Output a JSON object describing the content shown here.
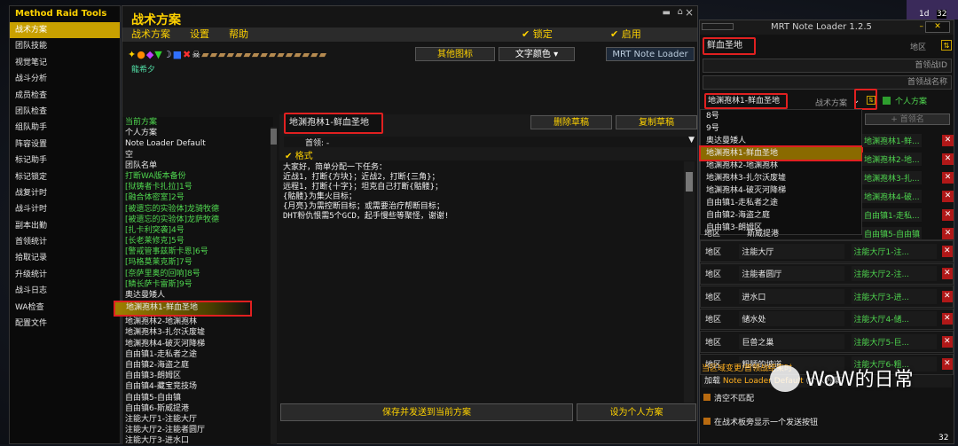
{
  "mrt_panel": {
    "title": "Method Raid Tools",
    "items": [
      "战术方案",
      "团队技能",
      "视觉笔记",
      "战斗分析",
      "成员检查",
      "团队检查",
      "组队助手",
      "阵容设置",
      "标记助手",
      "标记锁定",
      "战复计时",
      "战斗计时",
      "副本出勤",
      "首领统计",
      "拾取记录",
      "升级统计",
      "战斗日志",
      "WA检查",
      "配置文件"
    ]
  },
  "tactics": {
    "title": "战术方案",
    "menu": [
      "战术方案",
      "设置",
      "帮助"
    ],
    "lock_label": "锁定",
    "enable_label": "启用",
    "other_icons": "其他图标",
    "text_color": "文字颜色",
    "mrt_note_loader": "MRT Note Loader",
    "author": "龍希夕",
    "current_plan": "当前方案",
    "list": [
      "个人方案",
      "Note Loader Default",
      "空",
      "团队名单",
      "打断WA版本备份",
      "[狱铸者卡扎拉]1号",
      "[融合体密室]2号",
      "[被遗忘的实验体]龙骑牧德",
      "[被遗忘的实验体]龙萨牧德",
      "[扎卡利突袭]4号",
      "[长老莱修克]5号",
      "[警戒管事兹斯卡恩]6号",
      "[玛格莫莱克斯]7号",
      "[奈萨里奥的回响]8号",
      "[鳞长萨卡雷斯]9号",
      "奥达曼矮人",
      "地渊孢林1-鲜血圣地",
      "地渊孢林2-地渊孢林",
      "地渊孢林3-扎尔沃废墟",
      "地渊孢林4-破灭河降梯",
      "自由镇1-走私者之途",
      "自由镇2-海盗之庭",
      "自由镇3-朗姆区",
      "自由镇4-藏宝竞技场",
      "自由镇5-自由镇",
      "自由镇6-斯威提港",
      "注能大厅1-注能大厅",
      "注能大厅2-注能者圆厅",
      "注能大厅3-进水口"
    ],
    "note_title": "地渊孢林1-鲜血圣地",
    "delete_draft": "删除草稿",
    "copy_draft": "复制草稿",
    "boss_label": "首领:",
    "boss_value": "-",
    "format_label": "格式",
    "note_lines": [
      "大家好，简单分配一下任务：",
      "近战1，打断{方块}；近战2，打断{三角}；",
      "远程1，打断{十字}；坦克自己打断{骷髅}；",
      "{骷髅}为集火目标；",
      "{月亮}为需控断目标；或需要治疗帮断目标；",
      "DHT粉仇恨需5个GCD，起手慢些等聚怪，谢谢!"
    ],
    "save_send": "保存并发送到当前方案",
    "set_personal": "设为个人方案"
  },
  "note_loader": {
    "title": "MRT Note Loader 1.2.5",
    "top_value": "鲜血圣地",
    "zone_label": "地区",
    "boss_id_label": "首领战ID",
    "boss_name_label": "首领战名称",
    "selected_plan": "地渊孢林1-鲜血圣地",
    "plan_label": "战术方案",
    "personal_plan": "个人方案",
    "add_boss": "+ 首领名",
    "dropdown": [
      "8号",
      "9号",
      "奥达曼矮人",
      "地渊孢林1-鲜血圣地",
      "地渊孢林2-地渊孢林",
      "地渊孢林3-扎尔沃废墟",
      "地渊孢林4-破灭河降梯",
      "自由镇1-走私者之途",
      "自由镇2-海盗之庭",
      "自由镇3-朗姆区"
    ],
    "right_partial": [
      "地渊孢林1-鲜...",
      "地渊孢林2-地...",
      "地渊孢林3-扎...",
      "地渊孢林4-破...",
      "自由镇1-走私...",
      "自由镇5-自由镇",
      "自由镇6-斯威..."
    ],
    "rows": [
      {
        "type": "地区",
        "name": "注能大厅",
        "plan": "注能大厅1-注..."
      },
      {
        "type": "地区",
        "name": "注能者圆厅",
        "plan": "注能大厅2-注..."
      },
      {
        "type": "地区",
        "name": "进水口",
        "plan": "注能大厅3-进..."
      },
      {
        "type": "地区",
        "name": "储水处",
        "plan": "注能大厅4-储..."
      },
      {
        "type": "地区",
        "name": "巨兽之巢",
        "plan": "注能大厅5-巨..."
      },
      {
        "type": "地区",
        "name": "粗陋的坡道",
        "plan": "注能大厅6-粗..."
      }
    ],
    "partial_row": {
      "type": "地区",
      "name": "斯威提港"
    },
    "section_label": "当区域变更/首领战结束时",
    "load_prefix": "加载",
    "load_value": "Note Loader Default",
    "load_suffix": "(个人方案)",
    "clear_label": "清空不匹配",
    "send_label": "在战术板旁显示一个发送按钮",
    "send_word": "发送"
  },
  "watermark": "WoW的日常",
  "topright": {
    "val1": "32",
    "val2": "32",
    "frag": "1d"
  }
}
